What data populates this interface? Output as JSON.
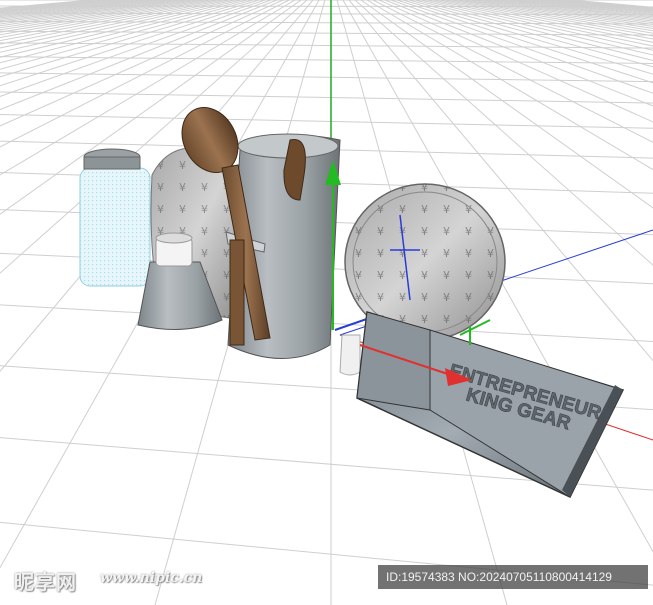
{
  "viewport": {
    "axis_colors": {
      "x": "#e03030",
      "y": "#22aa22",
      "z": "#2a3cd8"
    },
    "grid_color": "#c8c8c8",
    "background": "#ffffff"
  },
  "objects": [
    {
      "name": "mason-jar"
    },
    {
      "name": "oil-lamp"
    },
    {
      "name": "wooden-spoon"
    },
    {
      "name": "utensil-holder"
    },
    {
      "name": "cutting-board-back"
    },
    {
      "name": "round-lid"
    },
    {
      "name": "baking-pan"
    }
  ],
  "pan_text": {
    "line1": "ENTREPRENEUR",
    "line2": "KING GEAR"
  },
  "watermark": {
    "logo": "昵享网",
    "url": "www.nipic.cn",
    "id_text": "ID:19574383 NO:20240705110800414129"
  }
}
